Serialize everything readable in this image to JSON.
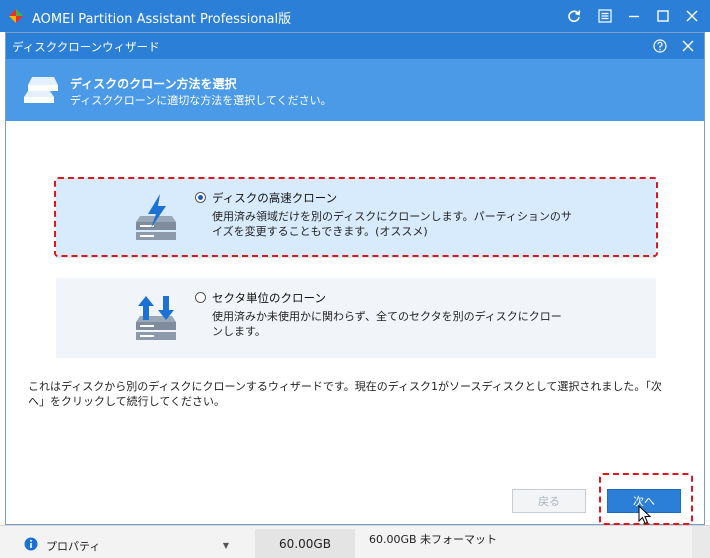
{
  "app": {
    "title": "AOMEI Partition Assistant Professional版",
    "icons": [
      "app-logo-icon",
      "refresh-icon",
      "menu-icon",
      "minimize-icon",
      "maximize-icon",
      "close-icon"
    ]
  },
  "dialog": {
    "title": "ディスククローンウィザード",
    "banner": {
      "title": "ディスクのクローン方法を選択",
      "subtitle": "ディスククローンに適切な方法を選択してください。"
    },
    "options": [
      {
        "label": "ディスクの高速クローン",
        "description": "使用済み領域だけを別のディスクにクローンします。パーティションのサイズを変更することもできます。(オススメ)",
        "selected": true
      },
      {
        "label": "セクタ単位のクローン",
        "description": "使用済みか未使用かに関わらず、全てのセクタを別のディスクにクローンします。",
        "selected": false
      }
    ],
    "info_text": "これはディスクから別のディスクにクローンするウィザードです。現在のディスク1がソースディスクとして選択されました。「次へ」をクリックして続行してください。",
    "buttons": {
      "back": "戻る",
      "next": "次へ"
    }
  },
  "bottom": {
    "properties_label": "プロパティ",
    "capacity": "60.00GB",
    "disk_info": "60.00GB 未フォーマット"
  },
  "colors": {
    "titlebar": "#2b7fd6",
    "banner": "#4a9ae8",
    "selected_option": "#d8ebfc",
    "highlight_dash": "#e0151f"
  }
}
